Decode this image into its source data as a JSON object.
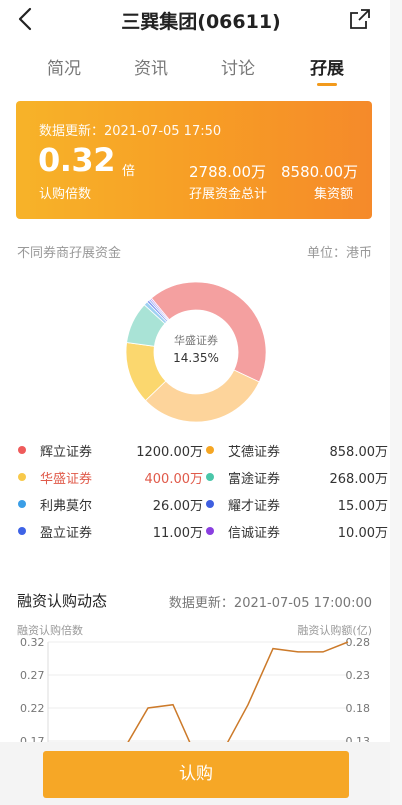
{
  "header": {
    "title": "三巽集团(06611)",
    "back_icon": "chevron-left-icon",
    "share_icon": "share-icon"
  },
  "tabs": [
    {
      "label": "简况",
      "active": false
    },
    {
      "label": "资讯",
      "active": false
    },
    {
      "label": "讨论",
      "active": false
    },
    {
      "label": "孖展",
      "active": true
    }
  ],
  "banner": {
    "update_time": "数据更新：2021-07-05 17:50",
    "subscription_multiple": "0.32",
    "multiple_unit": "倍",
    "multiple_label": "认购倍数",
    "margin_total": "2788.00万",
    "margin_total_label": "孖展资金总计",
    "fundraise": "8580.00万",
    "fundraise_label": "集资额"
  },
  "broker_section": {
    "title": "不同券商孖展资金",
    "unit": "单位：港币",
    "center_name": "华盛证券",
    "center_pct": "14.35%",
    "items": [
      {
        "name": "辉立证券",
        "value": "1200.00万",
        "amount": 1200,
        "color": "#f4a0a0",
        "dot": "#ef5b5b",
        "highlight": false
      },
      {
        "name": "艾德证券",
        "value": "858.00万",
        "amount": 858,
        "color": "#fdd49b",
        "dot": "#f5a623",
        "highlight": false
      },
      {
        "name": "华盛证券",
        "value": "400.00万",
        "amount": 400,
        "color": "#fbd76e",
        "dot": "#f8c94a",
        "highlight": true
      },
      {
        "name": "富途证券",
        "value": "268.00万",
        "amount": 268,
        "color": "#a9e3d6",
        "dot": "#4ac6a9",
        "highlight": false
      },
      {
        "name": "利弗莫尔",
        "value": "26.00万",
        "amount": 26,
        "color": "#9ed0f2",
        "dot": "#3b9ee6",
        "highlight": false
      },
      {
        "name": "耀才证券",
        "value": "15.00万",
        "amount": 15,
        "color": "#7f95f0",
        "dot": "#3f5fe0",
        "highlight": false
      },
      {
        "name": "盈立证券",
        "value": "11.00万",
        "amount": 11,
        "color": "#8aa6f2",
        "dot": "#3e63e6",
        "highlight": false
      },
      {
        "name": "信诚证券",
        "value": "10.00万",
        "amount": 10,
        "color": "#c39af0",
        "dot": "#8a3fe0",
        "highlight": false
      }
    ],
    "highlight_color": "#e05a4a"
  },
  "dynamics": {
    "title": "融资认购动态",
    "update_time": "数据更新：2021-07-05 17:00:00",
    "left_axis_label": "融资认购倍数",
    "right_axis_label": "融资认购额(亿)"
  },
  "chart_data": {
    "type": "line",
    "left_ticks": [
      "0.32",
      "0.27",
      "0.22",
      "0.17"
    ],
    "right_ticks": [
      "0.28",
      "0.23",
      "0.18",
      "0.13"
    ],
    "ylim": [
      0.17,
      0.32
    ],
    "values": [
      0.16,
      0.16,
      0.155,
      0.155,
      0.22,
      0.225,
      0.14,
      0.155,
      0.225,
      0.31,
      0.305,
      0.305,
      0.32
    ],
    "line_color": "#cc7a2a"
  },
  "footer": {
    "buy_label": "认购"
  }
}
